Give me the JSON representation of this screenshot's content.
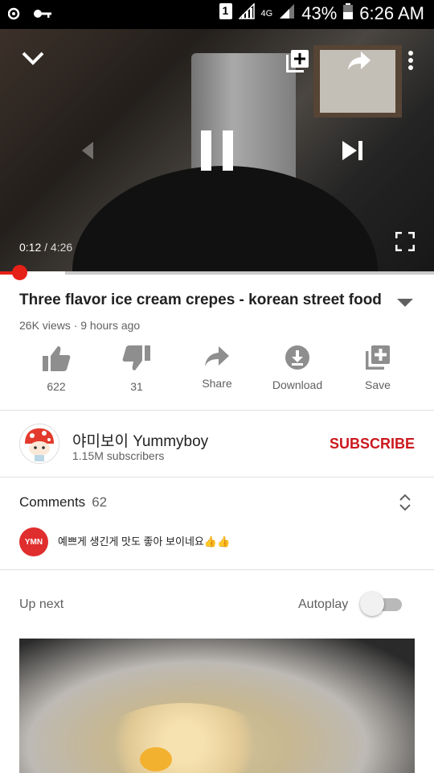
{
  "status_bar": {
    "sim_badge": "1",
    "network": "4G",
    "battery": "43%",
    "time": "6:26 AM"
  },
  "player": {
    "current_time": "0:12",
    "separator": " / ",
    "duration": "4:26",
    "progress": 0.045,
    "buffered": 0.15,
    "state": "paused-overlay"
  },
  "video": {
    "title": "Three flavor ice cream crepes - korean street food",
    "meta": "26K views · 9 hours ago"
  },
  "actions": [
    {
      "icon": "thumbs-up-icon",
      "label": "622"
    },
    {
      "icon": "thumbs-down-icon",
      "label": "31"
    },
    {
      "icon": "share-icon",
      "label": "Share"
    },
    {
      "icon": "download-icon",
      "label": "Download"
    },
    {
      "icon": "add-to-playlist-icon",
      "label": "Save"
    }
  ],
  "channel": {
    "name": "야미보이 Yummyboy",
    "subscribers": "1.15M subscribers",
    "subscribe_label": "SUBSCRIBE"
  },
  "comments": {
    "label": "Comments",
    "count": "62",
    "top_comment": {
      "avatar_text": "YMN",
      "text": "예쁘게 생긴게 맛도 좋아 보이네요👍👍"
    }
  },
  "up_next": {
    "label": "Up next",
    "autoplay_label": "Autoplay",
    "autoplay_on": false
  },
  "colors": {
    "brand_red": "#e62117",
    "subscribe_red": "#cc181e",
    "text_primary": "#212121",
    "text_secondary": "#606060"
  }
}
